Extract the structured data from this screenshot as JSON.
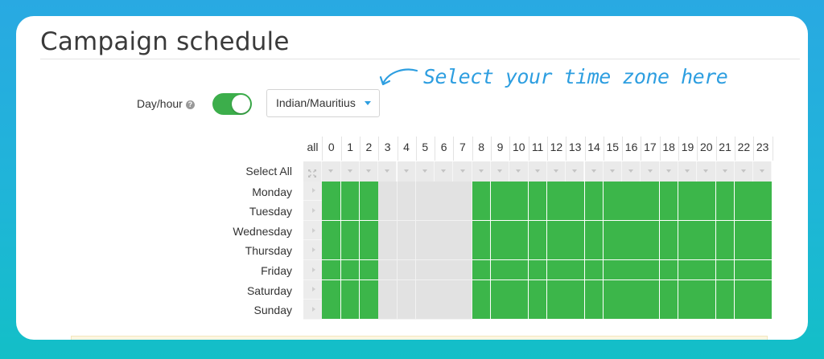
{
  "page": {
    "title": "Campaign schedule",
    "annotation": "Select your time zone here"
  },
  "controls": {
    "day_hour_label": "Day/hour",
    "help_icon": "question-circle-icon",
    "toggle_on": true,
    "timezone_value": "Indian/Mauritius"
  },
  "grid": {
    "all_label": "all",
    "select_all_label": "Select All",
    "hours": [
      "0",
      "1",
      "2",
      "3",
      "4",
      "5",
      "6",
      "7",
      "8",
      "9",
      "10",
      "11",
      "12",
      "13",
      "14",
      "15",
      "16",
      "17",
      "18",
      "19",
      "20",
      "21",
      "22",
      "23"
    ],
    "days": [
      "Monday",
      "Tuesday",
      "Wednesday",
      "Thursday",
      "Friday",
      "Saturday",
      "Sunday"
    ],
    "selected_hours": [
      0,
      1,
      2,
      8,
      9,
      10,
      11,
      12,
      13,
      14,
      15,
      16,
      17,
      18,
      19,
      20,
      21,
      22,
      23
    ],
    "colors": {
      "selected": "#3cb64a",
      "unselected": "#e2e2e2",
      "accent": "#2d9ee0"
    }
  }
}
